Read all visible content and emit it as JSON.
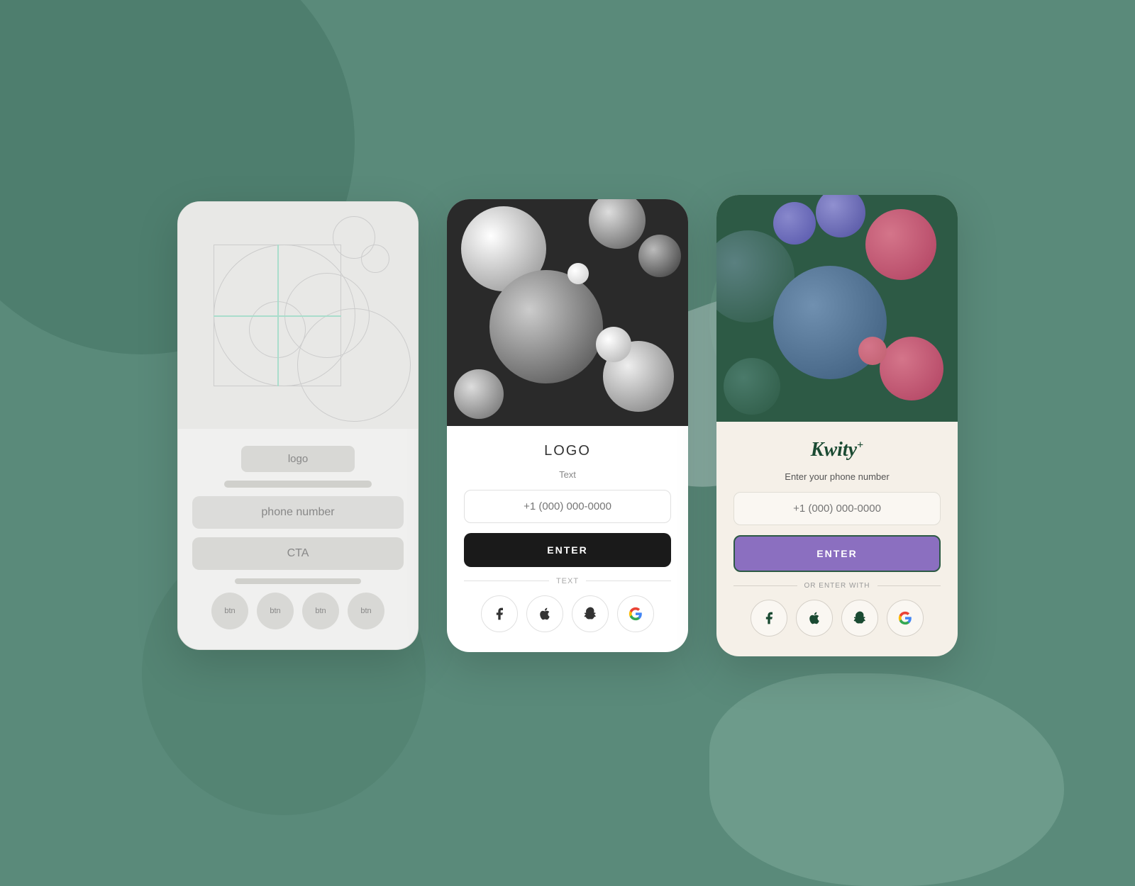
{
  "background": {
    "color": "#5a8a7a"
  },
  "cards": {
    "wireframe": {
      "logo_label": "logo",
      "phone_number_label": "phone number",
      "cta_label": "CTA",
      "btn_labels": [
        "btn",
        "btn",
        "btn",
        "btn"
      ]
    },
    "grayscale": {
      "logo_text": "LOGO",
      "text_label": "Text",
      "phone_placeholder": "+1 (000) 000-0000",
      "enter_label": "ENTER",
      "divider_text": "TEXT",
      "social_icons": [
        "facebook",
        "apple",
        "snapchat",
        "google"
      ]
    },
    "colored": {
      "logo_text": "Kwity",
      "logo_sup": "+",
      "subtitle": "Enter your phone number",
      "phone_placeholder": "+1 (000) 000-0000",
      "enter_label": "ENTER",
      "divider_text": "OR ENTER WITH",
      "social_icons": [
        "facebook",
        "apple",
        "snapchat",
        "google"
      ]
    }
  }
}
